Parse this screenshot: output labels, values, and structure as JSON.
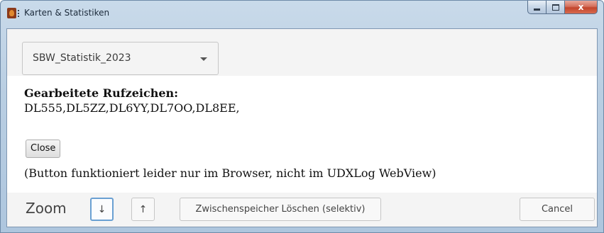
{
  "window": {
    "title": "Karten & Statistiken",
    "close_glyph": "x"
  },
  "selector": {
    "selected": "SBW_Statistik_2023"
  },
  "content": {
    "heading": "Gearbeitete Rufzeichen:",
    "calls": "DL555,DL5ZZ,DL6YY,DL7OO,DL8EE,",
    "close_label": "Close",
    "note": "(Button funktioniert leider nur im Browser, nicht im UDXLog WebView)"
  },
  "footer": {
    "zoom_label": "Zoom",
    "zoom_down_glyph": "↓",
    "zoom_up_glyph": "↑",
    "cache_label": "Zwischenspeicher Löschen (selektiv)",
    "cancel_label": "Cancel"
  }
}
